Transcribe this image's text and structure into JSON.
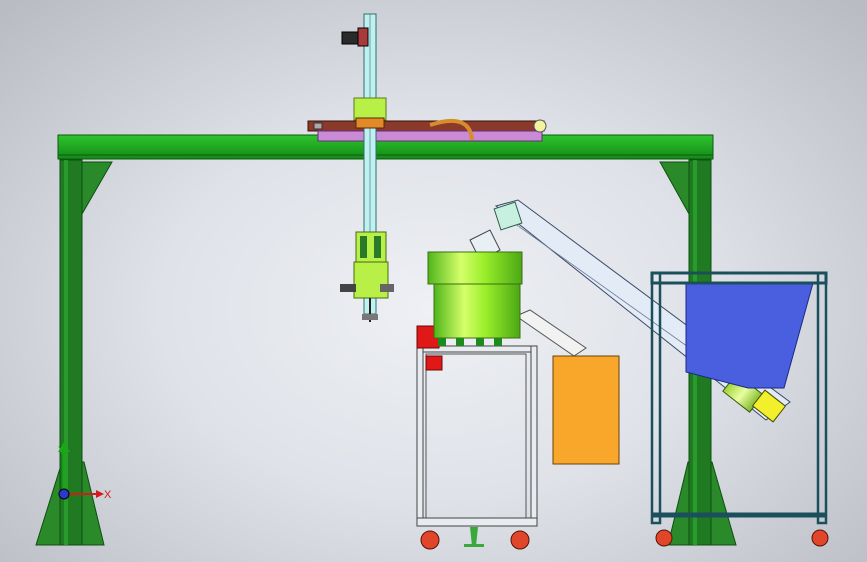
{
  "scene": {
    "background_colors": [
      "#eef0f4",
      "#b9bcc3"
    ],
    "colors": {
      "gantry_green": "#1fa81f",
      "gantry_dark": "#0f6e12",
      "gantry_leg": "#1f7a22",
      "slide_green": "#c8f04a",
      "bowl_green": "#8ee81e",
      "rail_purple": "#c98ad6",
      "conveyor_light": "#dfe8f4",
      "hopper_blue": "#4a5fe0",
      "cart_frame": "#1b4f5c",
      "box_orange": "#f9a72a",
      "mount_red": "#e01818",
      "caster_red": "#e0472a",
      "yellow_end": "#f2f02a"
    }
  },
  "triad": {
    "x_label": "X",
    "y_label": "Y"
  }
}
